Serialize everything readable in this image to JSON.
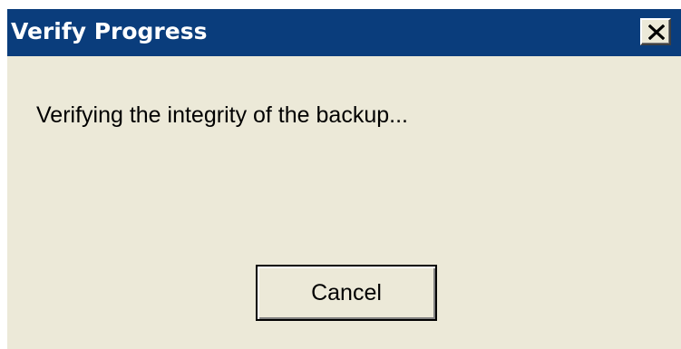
{
  "dialog": {
    "title": "Verify Progress",
    "message": "Verifying the integrity of the backup...",
    "cancel_label": "Cancel",
    "close_icon": "close-icon"
  },
  "colors": {
    "titlebar": "#0A3D7C",
    "title_text": "#FFFFFF",
    "window_bg": "#ECE9D8",
    "text": "#000000"
  }
}
